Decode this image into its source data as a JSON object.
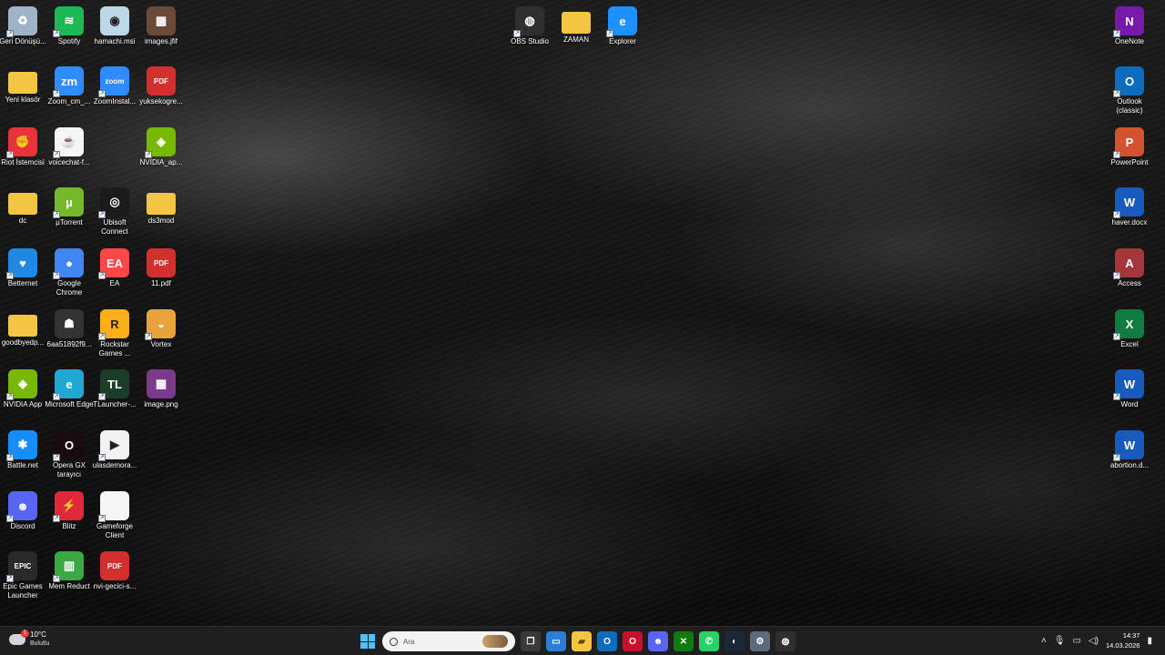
{
  "desktop_icons": [
    {
      "label": "Geri Dönüşü...",
      "icon": "recycle-bin-icon",
      "color": "#9fb3c8",
      "glyph": "♻"
    },
    {
      "label": "Spotify",
      "icon": "spotify-icon",
      "color": "#1db954",
      "glyph": "≋"
    },
    {
      "label": "hamachi.msi",
      "icon": "installer-icon",
      "color": "#bcd7e8",
      "glyph": "◉"
    },
    {
      "label": "images.jfif",
      "icon": "image-file-icon",
      "color": "#6b4a3a",
      "glyph": "▦"
    },
    {
      "label": "Yeni klasör",
      "icon": "folder-icon",
      "color": "#f4c542",
      "glyph": ""
    },
    {
      "label": "Zoom_cm_...",
      "icon": "zoom-icon",
      "color": "#2d8cff",
      "glyph": "zm"
    },
    {
      "label": "ZoomInstal...",
      "icon": "zoom-icon",
      "color": "#2d8cff",
      "glyph": "zoom"
    },
    {
      "label": "yuksekogre...",
      "icon": "pdf-icon",
      "color": "#d32f2f",
      "glyph": "PDF"
    },
    {
      "label": "Riot İstemcisi",
      "icon": "riot-icon",
      "color": "#e8333b",
      "glyph": "✊"
    },
    {
      "label": "voicechat-f...",
      "icon": "java-icon",
      "color": "#f5f5f5",
      "glyph": "☕"
    },
    {
      "label": "NVIDIA_ap...",
      "icon": "nvidia-icon",
      "color": "#76b900",
      "glyph": "◈"
    },
    {
      "label": "dc",
      "icon": "folder-icon",
      "color": "#f4c542",
      "glyph": ""
    },
    {
      "label": "µTorrent",
      "icon": "utorrent-icon",
      "color": "#76b82a",
      "glyph": "µ"
    },
    {
      "label": "Ubisoft Connect",
      "icon": "ubisoft-icon",
      "color": "#1b1b1b",
      "glyph": "◎"
    },
    {
      "label": "ds3mod",
      "icon": "folder-icon",
      "color": "#f4c542",
      "glyph": ""
    },
    {
      "label": "Betternet",
      "icon": "betternet-icon",
      "color": "#1e88e5",
      "glyph": "♥"
    },
    {
      "label": "Google Chrome",
      "icon": "chrome-icon",
      "color": "#4285f4",
      "glyph": "●"
    },
    {
      "label": "EA",
      "icon": "ea-icon",
      "color": "#ff4747",
      "glyph": "EA"
    },
    {
      "label": "11.pdf",
      "icon": "pdf-icon",
      "color": "#d32f2f",
      "glyph": "PDF"
    },
    {
      "label": "goodbyedp...",
      "icon": "folder-icon",
      "color": "#f4c542",
      "glyph": ""
    },
    {
      "label": "6aa51892f9...",
      "icon": "image-file-icon",
      "color": "#333333",
      "glyph": "☗"
    },
    {
      "label": "Rockstar Games ...",
      "icon": "rockstar-icon",
      "color": "#fcaf17",
      "glyph": "R"
    },
    {
      "label": "Vortex",
      "icon": "vortex-icon",
      "color": "#e8a33c",
      "glyph": "◒"
    },
    {
      "label": "NVIDIA App",
      "icon": "nvidia-icon",
      "color": "#76b900",
      "glyph": "◈"
    },
    {
      "label": "Microsoft Edge",
      "icon": "edge-icon",
      "color": "#1fa7d6",
      "glyph": "e"
    },
    {
      "label": "TLauncher-...",
      "icon": "tlauncher-icon",
      "color": "#1b3d2a",
      "glyph": "TL"
    },
    {
      "label": "image.png",
      "icon": "image-file-icon",
      "color": "#7a3b8a",
      "glyph": "▦"
    },
    {
      "label": "Battle.net",
      "icon": "battlenet-icon",
      "color": "#148eff",
      "glyph": "✱"
    },
    {
      "label": "Opera GX tarayıcı",
      "icon": "opera-gx-icon",
      "color": "#1a0b10",
      "glyph": "O"
    },
    {
      "label": "ulasdemora...",
      "icon": "video-file-icon",
      "color": "#f2f2f2",
      "glyph": "▶"
    },
    {
      "label": "Discord",
      "icon": "discord-icon",
      "color": "#5865f2",
      "glyph": "☻"
    },
    {
      "label": "Blitz",
      "icon": "blitz-icon",
      "color": "#e0283a",
      "glyph": "⚡"
    },
    {
      "label": "Gameforge Client",
      "icon": "file-icon",
      "color": "#f5f5f5",
      "glyph": ""
    },
    {
      "label": "Epic Games Launcher",
      "icon": "epic-games-icon",
      "color": "#2a2a2a",
      "glyph": "EPIC"
    },
    {
      "label": "Mem Reduct",
      "icon": "mem-reduct-icon",
      "color": "#3aa845",
      "glyph": "▥"
    },
    {
      "label": "nvi-gecici-s...",
      "icon": "pdf-icon",
      "color": "#d32f2f",
      "glyph": "PDF"
    },
    {
      "label": "OBS Studio",
      "icon": "obs-icon",
      "color": "#302e31",
      "glyph": "◍"
    },
    {
      "label": "ZAMAN",
      "icon": "folder-icon",
      "color": "#f4c542",
      "glyph": ""
    },
    {
      "label": "Explorer",
      "icon": "internet-explorer-icon",
      "color": "#1e90ff",
      "glyph": "e"
    },
    {
      "label": "OneNote",
      "icon": "onenote-icon",
      "color": "#7719aa",
      "glyph": "N"
    },
    {
      "label": "Outlook (classic)",
      "icon": "outlook-icon",
      "color": "#0f6cbd",
      "glyph": "O"
    },
    {
      "label": "PowerPoint",
      "icon": "powerpoint-icon",
      "color": "#d35230",
      "glyph": "P"
    },
    {
      "label": "haver.docx",
      "icon": "word-doc-icon",
      "color": "#185abd",
      "glyph": "W"
    },
    {
      "label": "Access",
      "icon": "access-icon",
      "color": "#a4373a",
      "glyph": "A"
    },
    {
      "label": "Excel",
      "icon": "excel-icon",
      "color": "#107c41",
      "glyph": "X"
    },
    {
      "label": "Word",
      "icon": "word-icon",
      "color": "#185abd",
      "glyph": "W"
    },
    {
      "label": "abortion.d...",
      "icon": "word-doc-icon",
      "color": "#185abd",
      "glyph": "W"
    }
  ],
  "taskbar": {
    "weather_temp": "10°C",
    "weather_desc": "Bulutlu",
    "weather_badge": "1",
    "search_placeholder": "Ara",
    "pinned": [
      {
        "name": "task-view-icon",
        "glyph": "❐",
        "color": "#3a3a3a"
      },
      {
        "name": "desktop-app-icon",
        "glyph": "▭",
        "color": "#2a7fd4"
      },
      {
        "name": "file-explorer-icon",
        "glyph": "▰",
        "color": "#f4c542"
      },
      {
        "name": "outlook-taskbar-icon",
        "glyph": "O",
        "color": "#0f6cbd"
      },
      {
        "name": "opera-gx-taskbar-icon",
        "glyph": "O",
        "color": "#c8102e"
      },
      {
        "name": "discord-taskbar-icon",
        "glyph": "☻",
        "color": "#5865f2"
      },
      {
        "name": "xbox-icon",
        "glyph": "✕",
        "color": "#107c10"
      },
      {
        "name": "whatsapp-icon",
        "glyph": "✆",
        "color": "#25d366"
      },
      {
        "name": "steam-icon",
        "glyph": "◐",
        "color": "#1b2838"
      },
      {
        "name": "settings-gear-icon",
        "glyph": "⚙",
        "color": "#5a6b7d"
      },
      {
        "name": "obs-taskbar-icon",
        "glyph": "◍",
        "color": "#302e31"
      }
    ],
    "time": "14:37",
    "date": "14.03.2026"
  }
}
